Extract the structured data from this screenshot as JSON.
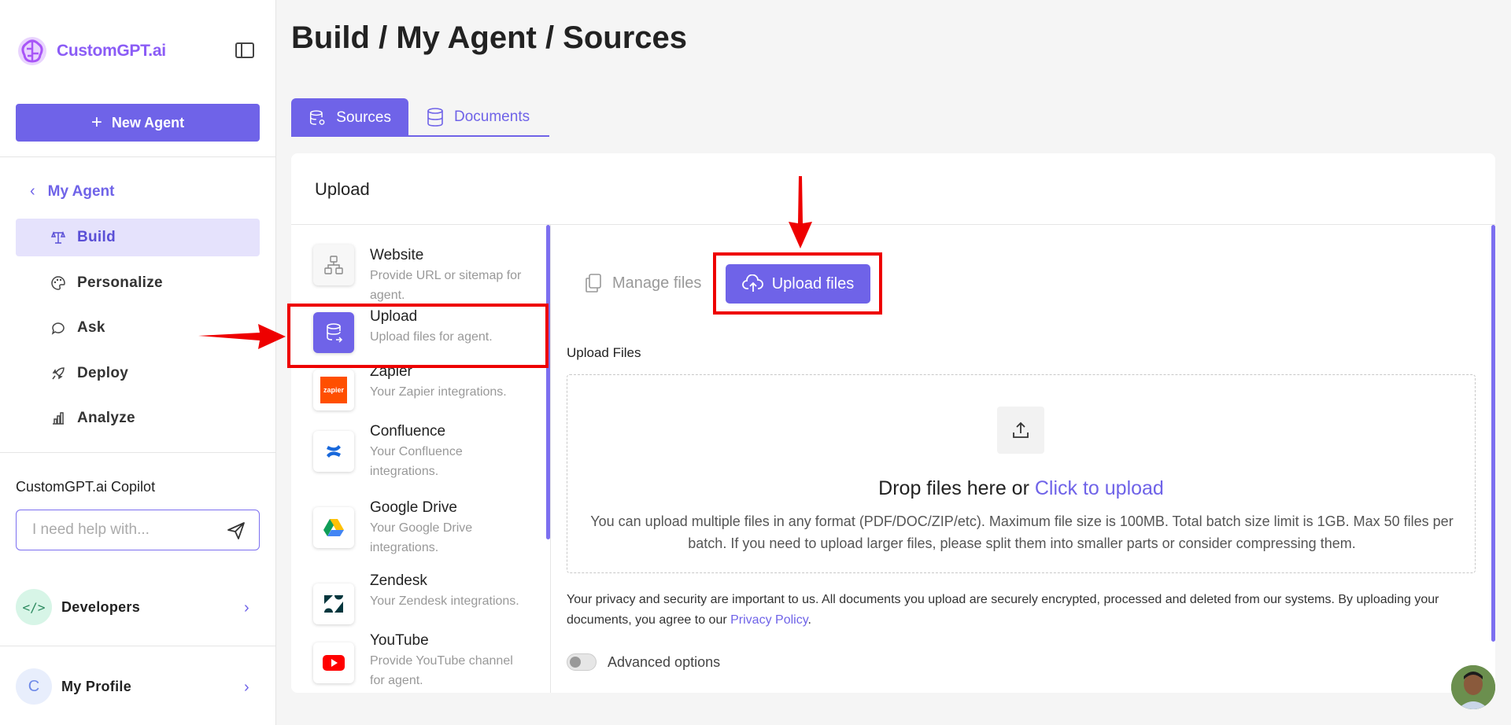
{
  "sidebar": {
    "logo_text": "CustomGPT.ai",
    "new_agent_label": "New Agent",
    "back_label": "My Agent",
    "nav": [
      {
        "label": "Build",
        "icon": "build-icon",
        "active": true
      },
      {
        "label": "Personalize",
        "icon": "palette-icon",
        "active": false
      },
      {
        "label": "Ask",
        "icon": "chat-icon",
        "active": false
      },
      {
        "label": "Deploy",
        "icon": "rocket-icon",
        "active": false
      },
      {
        "label": "Analyze",
        "icon": "bar-chart-icon",
        "active": false
      }
    ],
    "copilot_title": "CustomGPT.ai Copilot",
    "copilot_placeholder": "I need help with...",
    "developers_label": "Developers",
    "developers_icon_text": "</>",
    "profile_label": "My Profile",
    "profile_initial": "C"
  },
  "header": {
    "title": "Build / My Agent / Sources"
  },
  "tabs": [
    {
      "label": "Sources",
      "active": true
    },
    {
      "label": "Documents",
      "active": false
    }
  ],
  "card": {
    "title": "Upload",
    "sources": [
      {
        "name": "Website",
        "desc": "Provide URL or sitemap for agent."
      },
      {
        "name": "Upload",
        "desc": "Upload files for agent."
      },
      {
        "name": "Zapier",
        "desc": "Your Zapier integrations.",
        "icon_text": "zapier"
      },
      {
        "name": "Confluence",
        "desc": "Your Confluence integrations."
      },
      {
        "name": "Google Drive",
        "desc": "Your Google Drive integrations."
      },
      {
        "name": "Zendesk",
        "desc": "Your Zendesk integrations."
      },
      {
        "name": "YouTube",
        "desc": "Provide YouTube channel for agent."
      }
    ],
    "manage_files_label": "Manage files",
    "upload_files_label": "Upload files",
    "upload_section_label": "Upload Files",
    "drop_text": "Drop files here or ",
    "drop_link": "Click to upload",
    "drop_desc": "You can upload multiple files in any format (PDF/DOC/ZIP/etc). Maximum file size is 100MB. Total batch size limit is 1GB. Max 50 files per batch. If you need to upload larger files, please split them into smaller parts or consider compressing them.",
    "privacy_text": "Your privacy and security are important to us. All documents you upload are securely encrypted, processed and deleted from our systems. By uploading your documents, you agree to our ",
    "privacy_link": "Privacy Policy",
    "privacy_end": ".",
    "advanced_label": "Advanced options"
  },
  "colors": {
    "accent": "#6f63e8",
    "highlight": "#ee0000"
  }
}
